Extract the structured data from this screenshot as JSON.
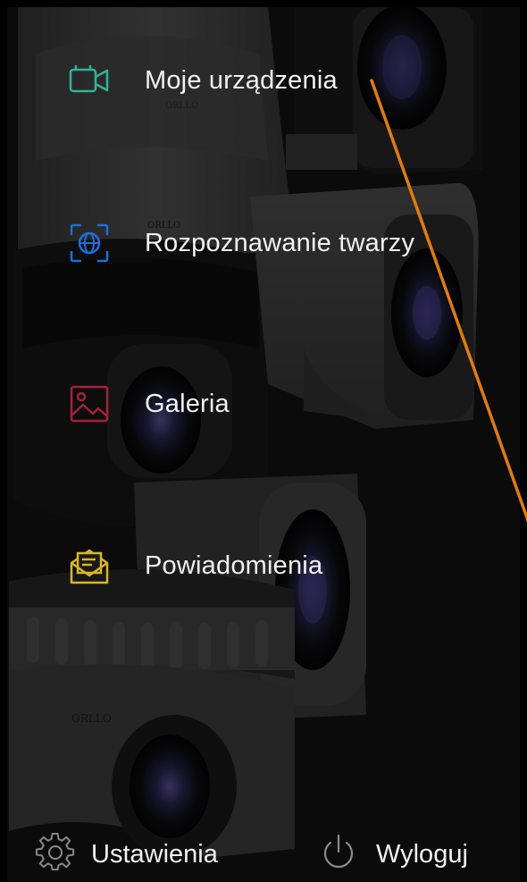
{
  "menu": {
    "items": [
      {
        "label": "Moje urządzenia",
        "icon": "video-camera-icon",
        "color": "#2fb39b"
      },
      {
        "label": "Rozpoznawanie twarzy",
        "icon": "face-recognition-icon",
        "color": "#1e6fd9"
      },
      {
        "label": "Galeria",
        "icon": "gallery-image-icon",
        "color": "#a8203a"
      },
      {
        "label": "Powiadomienia",
        "icon": "envelope-icon",
        "color": "#d8b62a"
      }
    ]
  },
  "bottom_bar": {
    "settings_label": "Ustawienia",
    "settings_icon": "gear-icon",
    "logout_label": "Wyloguj",
    "logout_icon": "power-icon"
  },
  "background": {
    "brand_text_1": "ORLLO",
    "brand_text_2": "ORLLO",
    "brand_text_3": "ORLLO"
  },
  "colors": {
    "annotation_line": "#e07b12",
    "text": "#f2f2f2",
    "background": "#141414"
  }
}
